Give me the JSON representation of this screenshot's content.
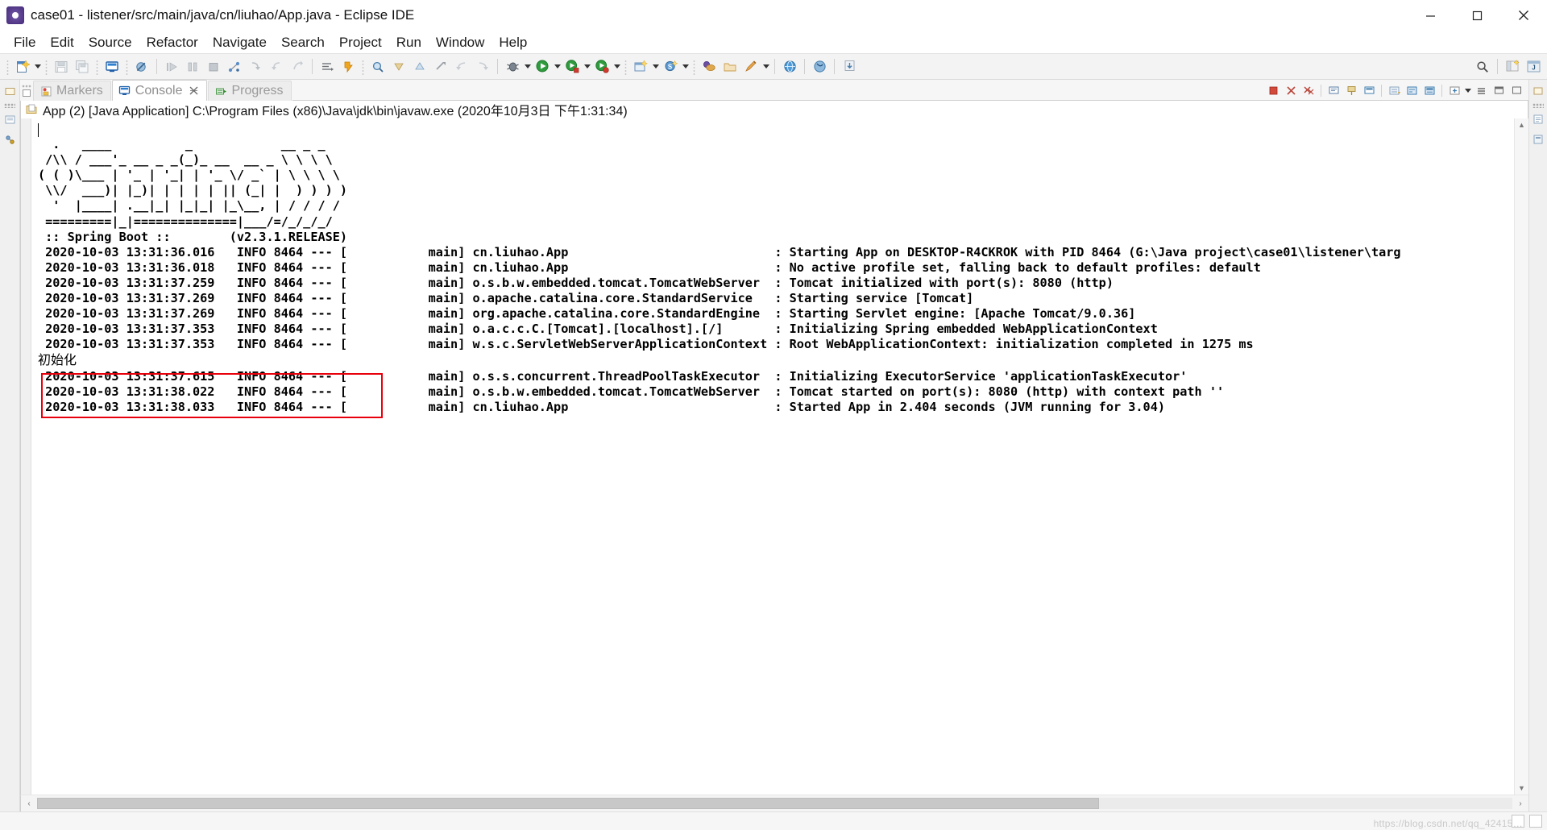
{
  "window": {
    "title": "case01 - listener/src/main/java/cn/liuhao/App.java - Eclipse IDE",
    "minimize_label": "─",
    "maximize_label": "❐",
    "close_label": "✕"
  },
  "menu": {
    "items": [
      "File",
      "Edit",
      "Source",
      "Refactor",
      "Navigate",
      "Search",
      "Project",
      "Run",
      "Window",
      "Help"
    ]
  },
  "toolbar": {
    "groups": [
      [
        "new-wizard-icon",
        "new-wizard-dropdown"
      ],
      [
        "save-icon",
        "save-all-icon"
      ],
      [
        "toggle-console-icon"
      ],
      [
        "skip-breakpoints-icon"
      ],
      [
        "resume-icon",
        "suspend-icon",
        "terminate-icon",
        "disconnect-icon",
        "step-into-icon",
        "step-over-icon",
        "step-return-icon"
      ],
      [
        "open-type-icon",
        "open-task-icon"
      ],
      [
        "search-icon",
        "next-annotation-icon",
        "previous-annotation-icon",
        "last-edit-location-icon",
        "back-icon",
        "forward-icon"
      ],
      [
        "debug-icon",
        "debug-dropdown",
        "run-icon",
        "run-dropdown",
        "coverage-icon",
        "coverage-dropdown",
        "external-tools-icon",
        "external-tools-dropdown"
      ],
      [
        "new-java-project-icon",
        "new-java-project-dropdown",
        "new-class-icon",
        "new-class-dropdown"
      ],
      [
        "spring-boot-icon",
        "open-perspective-icon",
        "quick-access-icon",
        "quick-access-dropdown"
      ],
      [
        "web-browser-icon",
        "run-server-icon",
        "download-icon"
      ]
    ],
    "right_icons": [
      "quick-access-search-icon",
      "open-perspective-icon",
      "java-perspective-icon"
    ]
  },
  "view_tabs": [
    {
      "label": "Markers",
      "icon": "markers-icon",
      "active": false,
      "closable": false
    },
    {
      "label": "Console",
      "icon": "console-icon",
      "active": true,
      "closable": true
    },
    {
      "label": "Progress",
      "icon": "progress-icon",
      "active": false,
      "closable": false
    }
  ],
  "view_toolbar_icons": [
    "terminate-icon",
    "remove-launch-icon",
    "remove-all-terminated-icon",
    "open-console-icon",
    "pin-console-icon",
    "display-selected-console-icon",
    "scroll-lock-icon",
    "word-wrap-icon",
    "show-console-on-output-icon",
    "new-console-view-icon",
    "new-console-dropdown",
    "view-menu-icon",
    "minimize-icon",
    "maximize-icon"
  ],
  "console": {
    "header_icon": "java-launch-icon",
    "header": "App (2) [Java Application] C:\\Program Files (x86)\\Java\\jdk\\bin\\javaw.exe  (2020年10月3日 下午1:31:34)",
    "banner_lines": [
      "",
      "  .   ____          _            __ _ _",
      " /\\\\ / ___'_ __ _ _(_)_ __  __ _ \\ \\ \\ \\",
      "( ( )\\___ | '_ | '_| | '_ \\/ _` | \\ \\ \\ \\",
      " \\\\/  ___)| |_)| | | | | || (_| |  ) ) ) )",
      "  '  |____| .__|_| |_|_| |_\\__, | / / / /",
      " =========|_|==============|___/=/_/_/_/",
      " :: Spring Boot ::        (v2.3.1.RELEASE)",
      ""
    ],
    "log_lines": [
      {
        "timestamp": "2020-10-03 13:31:36.016",
        "level": "INFO",
        "pid": "8464",
        "thread": "main",
        "logger": "cn.liuhao.App",
        "message": "Starting App on DESKTOP-R4CKROK with PID 8464 (G:\\Java project\\case01\\listener\\targ"
      },
      {
        "timestamp": "2020-10-03 13:31:36.018",
        "level": "INFO",
        "pid": "8464",
        "thread": "main",
        "logger": "cn.liuhao.App",
        "message": "No active profile set, falling back to default profiles: default"
      },
      {
        "timestamp": "2020-10-03 13:31:37.259",
        "level": "INFO",
        "pid": "8464",
        "thread": "main",
        "logger": "o.s.b.w.embedded.tomcat.TomcatWebServer",
        "message": "Tomcat initialized with port(s): 8080 (http)"
      },
      {
        "timestamp": "2020-10-03 13:31:37.269",
        "level": "INFO",
        "pid": "8464",
        "thread": "main",
        "logger": "o.apache.catalina.core.StandardService",
        "message": "Starting service [Tomcat]"
      },
      {
        "timestamp": "2020-10-03 13:31:37.269",
        "level": "INFO",
        "pid": "8464",
        "thread": "main",
        "logger": "org.apache.catalina.core.StandardEngine",
        "message": "Starting Servlet engine: [Apache Tomcat/9.0.36]"
      },
      {
        "timestamp": "2020-10-03 13:31:37.353",
        "level": "INFO",
        "pid": "8464",
        "thread": "main",
        "logger": "o.a.c.c.C.[Tomcat].[localhost].[/]",
        "message": "Initializing Spring embedded WebApplicationContext"
      },
      {
        "timestamp": "2020-10-03 13:31:37.353",
        "level": "INFO",
        "pid": "8464",
        "thread": "main",
        "logger": "w.s.c.ServletWebServerApplicationContext",
        "message": "Root WebApplicationContext: initialization completed in 1275 ms"
      },
      {
        "timestamp": "",
        "level": "",
        "pid": "",
        "thread": "",
        "logger": "",
        "message": "",
        "chinese_text": "初始化"
      },
      {
        "timestamp": "2020-10-03 13:31:37.615",
        "level": "INFO",
        "pid": "8464",
        "thread": "main",
        "logger": "o.s.s.concurrent.ThreadPoolTaskExecutor",
        "message": "Initializing ExecutorService 'applicationTaskExecutor'"
      },
      {
        "timestamp": "2020-10-03 13:31:38.022",
        "level": "INFO",
        "pid": "8464",
        "thread": "main",
        "logger": "o.s.b.w.embedded.tomcat.TomcatWebServer",
        "message": "Tomcat started on port(s): 8080 (http) with context path ''"
      },
      {
        "timestamp": "2020-10-03 13:31:38.033",
        "level": "INFO",
        "pid": "8464",
        "thread": "main",
        "logger": "cn.liuhao.App",
        "message": "Started App in 2.404 seconds (JVM running for 3.04)"
      }
    ]
  },
  "annotation": {
    "box_color": "#e8000d",
    "chinese_label": "初始化"
  },
  "scrollbars": {
    "h_left_arrow": "‹",
    "h_right_arrow": "›",
    "v_up_arrow": "▲",
    "v_down_arrow": "▼"
  },
  "status": {
    "watermark": "https://blog.csdn.net/qq_42415…"
  },
  "colors": {
    "accent_red": "#e8000d",
    "window_bg": "#f6f6f6",
    "console_bg": "#ffffff",
    "text": "#000000",
    "tab_inactive_text": "#9a9a9a"
  }
}
